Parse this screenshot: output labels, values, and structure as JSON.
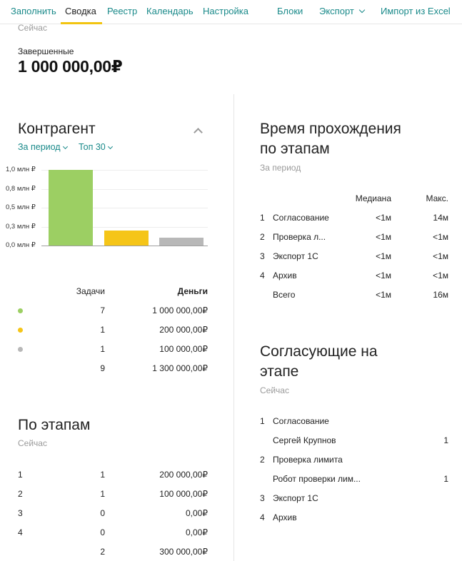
{
  "nav": {
    "items": [
      "Заполнить",
      "Сводка",
      "Реестр",
      "Календарь",
      "Настройка",
      "Блоки",
      "Экспорт",
      "Импорт из Excel"
    ],
    "active": "Сводка"
  },
  "summary": {
    "timeframe": "Сейчас",
    "completed_label": "Завершенные",
    "completed_value": "1 000 000,00₽"
  },
  "counterparty": {
    "title": "Контрагент",
    "filter_period": "За период",
    "filter_top": "Топ 30",
    "columns": {
      "tasks": "Задачи",
      "money": "Деньги"
    },
    "rows": [
      {
        "color": "#9ccf63",
        "tasks": "7",
        "money": "1 000 000,00₽"
      },
      {
        "color": "#f5c518",
        "tasks": "1",
        "money": "200 000,00₽"
      },
      {
        "color": "#b8b8b8",
        "tasks": "1",
        "money": "100 000,00₽"
      }
    ],
    "total": {
      "tasks": "9",
      "money": "1 300 000,00₽"
    }
  },
  "chart_data": {
    "type": "bar",
    "categories": [
      "",
      "",
      ""
    ],
    "values": [
      1000000,
      200000,
      100000
    ],
    "colors": [
      "#9ccf63",
      "#f5c518",
      "#b8b8b8"
    ],
    "ylim": [
      0,
      1000000
    ],
    "yticks": [
      {
        "value": 1000000,
        "label": "1,0 млн ₽"
      },
      {
        "value": 750000,
        "label": "0,8 млн ₽"
      },
      {
        "value": 500000,
        "label": "0,5 млн ₽"
      },
      {
        "value": 250000,
        "label": "0,3 млн ₽"
      },
      {
        "value": 0,
        "label": "0,0 млн ₽"
      }
    ],
    "grid": true
  },
  "stages": {
    "title": "По этапам",
    "timeframe": "Сейчас",
    "rows": [
      {
        "num": "1",
        "count": "1",
        "money": "200 000,00₽"
      },
      {
        "num": "2",
        "count": "1",
        "money": "100 000,00₽"
      },
      {
        "num": "3",
        "count": "0",
        "money": "0,00₽"
      },
      {
        "num": "4",
        "count": "0",
        "money": "0,00₽"
      }
    ],
    "total": {
      "count": "2",
      "money": "300 000,00₽"
    }
  },
  "time": {
    "title_line1": "Время прохождения",
    "title_line2": "по этапам",
    "timeframe": "За период",
    "columns": {
      "median": "Медиана",
      "max": "Макс."
    },
    "rows": [
      {
        "num": "1",
        "name": "Согласование",
        "median": "<1м",
        "max": "14м"
      },
      {
        "num": "2",
        "name": "Проверка л...",
        "median": "<1м",
        "max": "<1м"
      },
      {
        "num": "3",
        "name": "Экспорт 1С",
        "median": "<1м",
        "max": "<1м"
      },
      {
        "num": "4",
        "name": "Архив",
        "median": "<1м",
        "max": "<1м"
      }
    ],
    "total": {
      "name": "Всего",
      "median": "<1м",
      "max": "16м"
    }
  },
  "approvers": {
    "title_line1": "Согласующие на",
    "title_line2": "этапе",
    "timeframe": "Сейчас",
    "items": [
      {
        "num": "1",
        "name": "Согласование"
      },
      {
        "num": "",
        "name": "Сергей Крупнов",
        "count": "1"
      },
      {
        "num": "2",
        "name": "Проверка лимита"
      },
      {
        "num": "",
        "name": "Робот проверки лим...",
        "count": "1"
      },
      {
        "num": "3",
        "name": "Экспорт 1С"
      },
      {
        "num": "4",
        "name": "Архив"
      }
    ]
  }
}
